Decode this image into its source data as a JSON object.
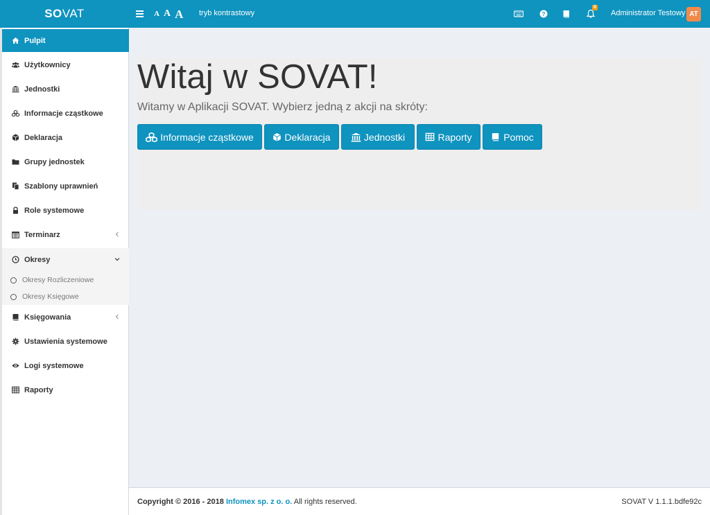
{
  "colors": {
    "primary": "#0f93bf",
    "accent_badge": "#f39c12",
    "avatar": "#f08a4b"
  },
  "header": {
    "logo_bold": "SO",
    "logo_light": "VAT",
    "font_small": "A",
    "font_medium": "A",
    "font_large": "A",
    "contrast_label": "tryb kontrastowy",
    "notifications_count": "0",
    "user_name": "Administrator Testowy",
    "avatar_initials": "AT"
  },
  "sidebar": {
    "items": [
      {
        "label": "Pulpit",
        "icon": "home-icon"
      },
      {
        "label": "Użytkownicy",
        "icon": "users-icon"
      },
      {
        "label": "Jednostki",
        "icon": "bank-icon"
      },
      {
        "label": "Informacje cząstkowe",
        "icon": "cubes-icon"
      },
      {
        "label": "Deklaracja",
        "icon": "cube-icon"
      },
      {
        "label": "Grupy jednostek",
        "icon": "folder-icon"
      },
      {
        "label": "Szablony uprawnień",
        "icon": "copy-icon"
      },
      {
        "label": "Role systemowe",
        "icon": "lock-icon"
      },
      {
        "label": "Terminarz",
        "icon": "calendar-icon"
      },
      {
        "label": "Okresy",
        "icon": "clock-icon"
      },
      {
        "label": "Księgowania",
        "icon": "book-icon"
      },
      {
        "label": "Ustawienia systemowe",
        "icon": "gear-icon"
      },
      {
        "label": "Logi systemowe",
        "icon": "eye-icon"
      },
      {
        "label": "Raporty",
        "icon": "table-icon"
      }
    ],
    "subitems": [
      {
        "label": "Okresy Rozliczeniowe"
      },
      {
        "label": "Okresy Księgowe"
      }
    ]
  },
  "main": {
    "title": "Witaj w SOVAT!",
    "subtitle": "Witamy w Aplikacji SOVAT. Wybierz jedną z akcji na skróty:",
    "buttons": [
      {
        "label": "Informacje cząstkowe",
        "icon": "cubes-icon"
      },
      {
        "label": "Deklaracja",
        "icon": "cube-icon"
      },
      {
        "label": "Jednostki",
        "icon": "bank-icon"
      },
      {
        "label": "Raporty",
        "icon": "table-icon"
      },
      {
        "label": "Pomoc",
        "icon": "book-icon"
      }
    ]
  },
  "footer": {
    "copyright": "Copyright © 2016 - 2018",
    "company": "Infomex sp. z o. o.",
    "rights": "All rights reserved.",
    "version": "SOVAT V 1.1.1.bdfe92c"
  }
}
